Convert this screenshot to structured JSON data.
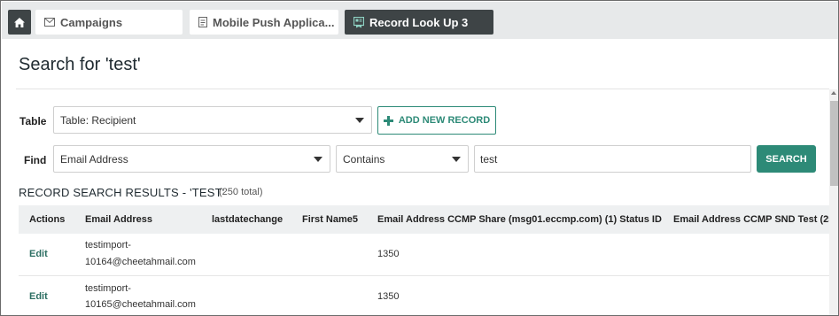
{
  "tabs": [
    {
      "label": "Campaigns",
      "icon": "mail-icon",
      "active": false
    },
    {
      "label": "Mobile Push Applica...",
      "icon": "document-icon",
      "active": false
    },
    {
      "label": "Record Look Up 3",
      "icon": "record-lookup-icon",
      "active": true
    }
  ],
  "page": {
    "title": "Search for 'test'"
  },
  "form": {
    "table_label": "Table",
    "table_value": "Table: Recipient",
    "add_button": "ADD NEW RECORD",
    "find_label": "Find",
    "field_value": "Email Address",
    "operator_value": "Contains",
    "search_value": "test",
    "search_button": "SEARCH"
  },
  "results": {
    "title": "RECORD SEARCH RESULTS - 'TEST'",
    "total": "(250 total)",
    "columns": [
      "Actions",
      "Email Address",
      "lastdatechange",
      "First Name5",
      "Email Address CCMP Share (msg01.eccmp.com) (1) Status ID",
      "Email Address CCMP SND Test (25"
    ],
    "rows": [
      {
        "action": "Edit",
        "email_line1": "testimport-",
        "email_line2": "10164@cheetahmail.com",
        "status_id": "1350"
      },
      {
        "action": "Edit",
        "email_line1": "testimport-",
        "email_line2": "10165@cheetahmail.com",
        "status_id": "1350"
      }
    ]
  },
  "colors": {
    "accent": "#2d8a77",
    "tab_dark": "#3e4446",
    "tabbar_bg": "#e7e9ea"
  }
}
